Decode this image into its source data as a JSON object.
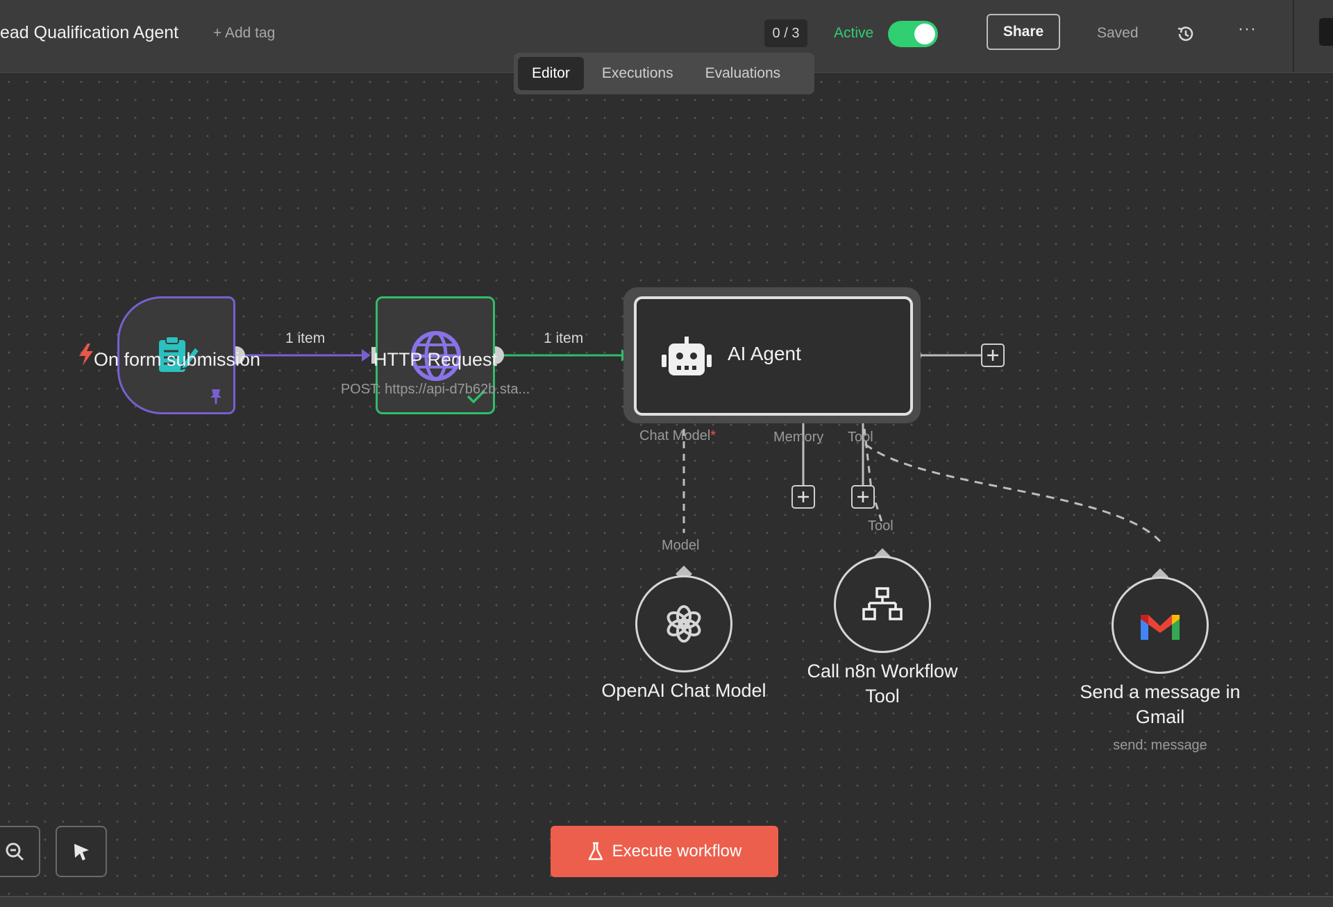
{
  "header": {
    "workflow_name": "ead Qualification Agent",
    "add_tag": "+ Add tag",
    "execution_counter": "0 / 3",
    "active_label": "Active",
    "active": true,
    "share_label": "Share",
    "saved_label": "Saved",
    "more_label": "···"
  },
  "tabs": [
    {
      "label": "Editor",
      "active": true
    },
    {
      "label": "Executions",
      "active": false
    },
    {
      "label": "Evaluations",
      "active": false
    }
  ],
  "colors": {
    "accent_green": "#2fcf72",
    "trigger_purple": "#7a5fd0",
    "execute_red": "#ec5f4c",
    "teal_icon": "#2cc0c0"
  },
  "nodes": {
    "form": {
      "label": "On form submission",
      "icon": "form-icon",
      "pinned": true
    },
    "http": {
      "label": "HTTP Request",
      "subtitle": "POST: https://api-d7b62b.sta...",
      "icon": "globe-icon",
      "success": true
    },
    "agent": {
      "label": "AI Agent",
      "icon": "robot-icon",
      "ports": {
        "chat_model": "Chat Model",
        "chat_model_required": "*",
        "memory": "Memory",
        "tool": "Tool"
      }
    },
    "openai": {
      "label": "OpenAI Chat Model",
      "port_label": "Model",
      "icon": "openai-icon"
    },
    "n8n_tool": {
      "label_line1": "Call n8n Workflow",
      "label_line2": "Tool",
      "port_label": "Tool",
      "icon": "sitemap-icon"
    },
    "gmail": {
      "label_line1": "Send a message in",
      "label_line2": "Gmail",
      "subtitle": "send: message",
      "icon": "gmail-icon"
    }
  },
  "connections": {
    "form_to_http": "1 item",
    "http_to_agent": "1 item"
  },
  "footer": {
    "execute_label": "Execute workflow"
  }
}
